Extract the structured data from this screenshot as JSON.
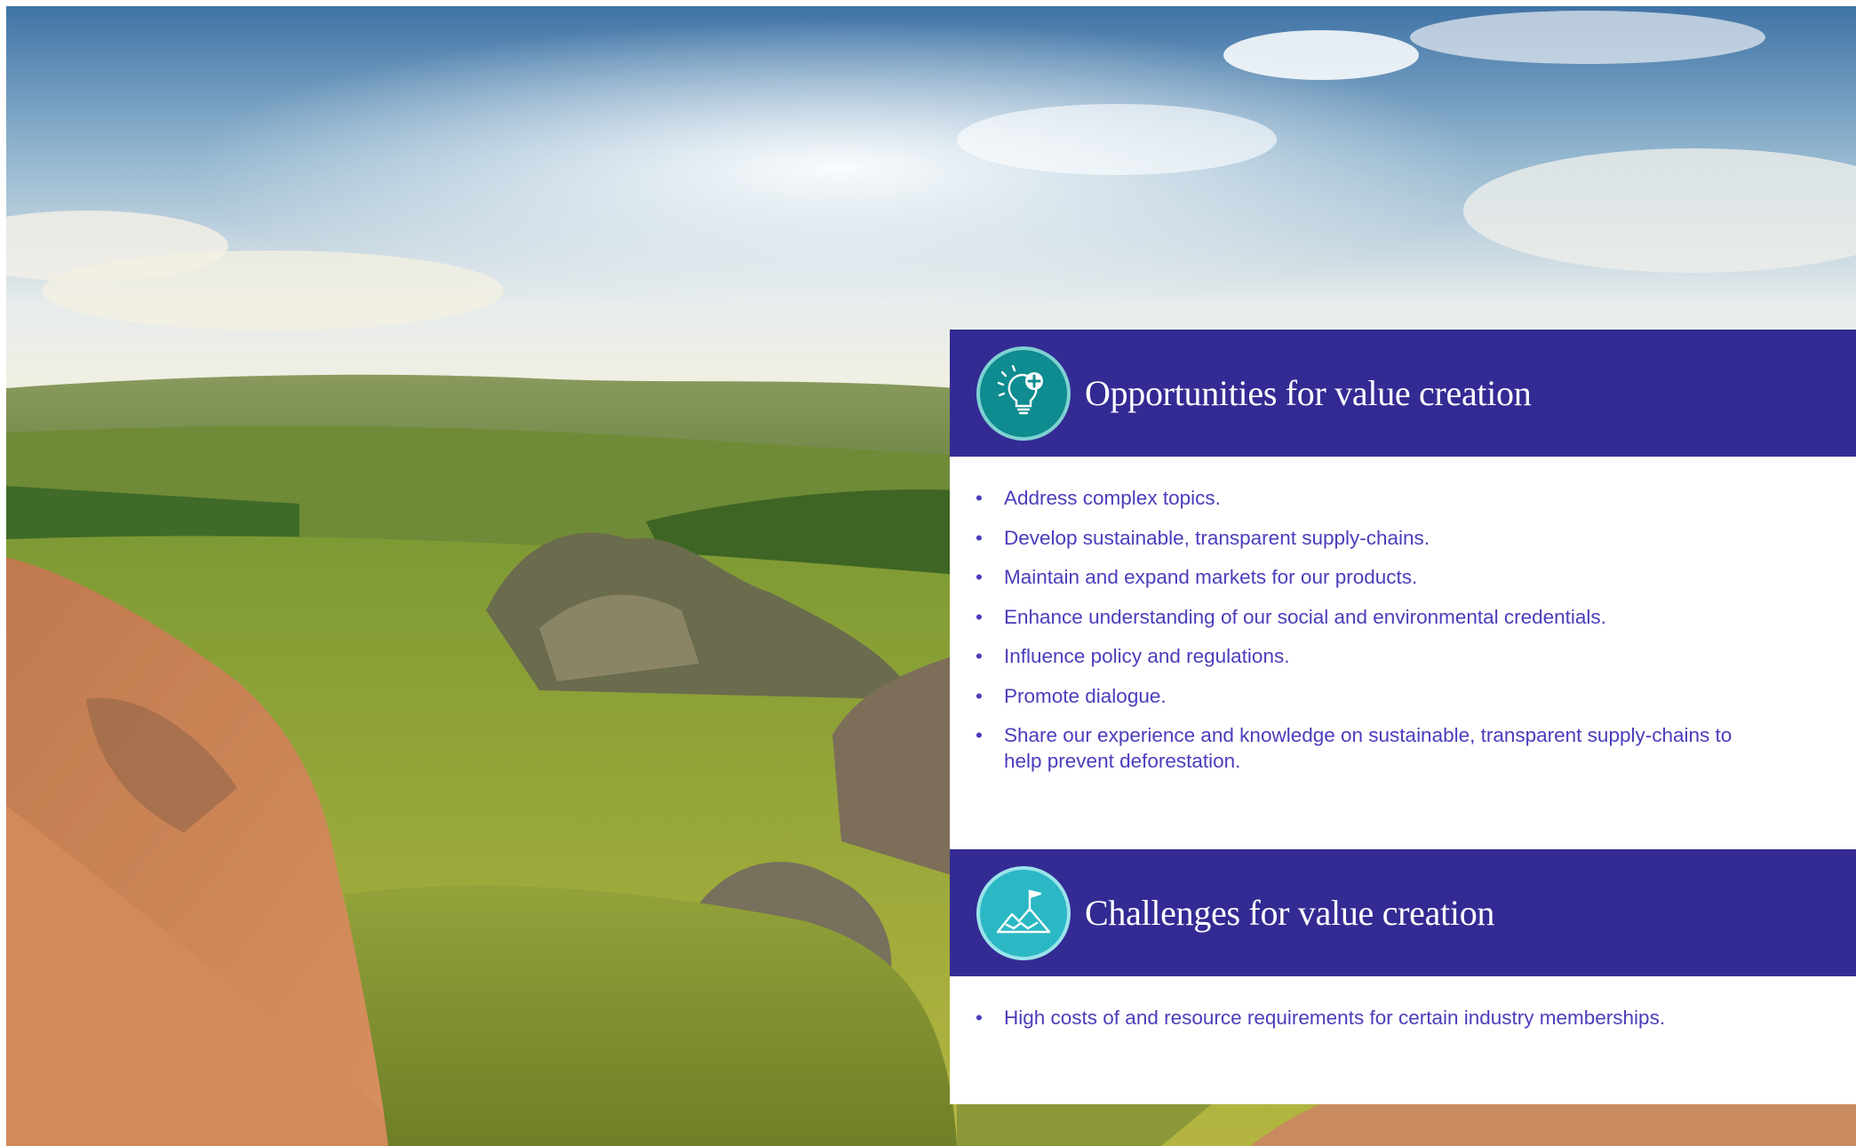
{
  "opportunities": {
    "title": "Opportunities for value creation",
    "icon": "lightbulb-plus-icon",
    "items": [
      "Address complex topics.",
      "Develop sustainable, transparent supply-chains.",
      "Maintain and expand markets for our products.",
      "Enhance understanding of our social and environmental credentials.",
      "Influence policy and regulations.",
      "Promote dialogue.",
      "Share our experience and knowledge on sustainable, transparent supply-chains to help prevent deforestation."
    ]
  },
  "challenges": {
    "title": "Challenges for value creation",
    "icon": "mountain-flag-icon",
    "items": [
      "High costs of and resource requirements for certain industry memberships."
    ]
  },
  "colors": {
    "header_bg": "#332b93",
    "bullet_text": "#4a3dbc",
    "opportunity_icon": "#0e8c8f",
    "challenge_icon": "#2bb8c4"
  }
}
